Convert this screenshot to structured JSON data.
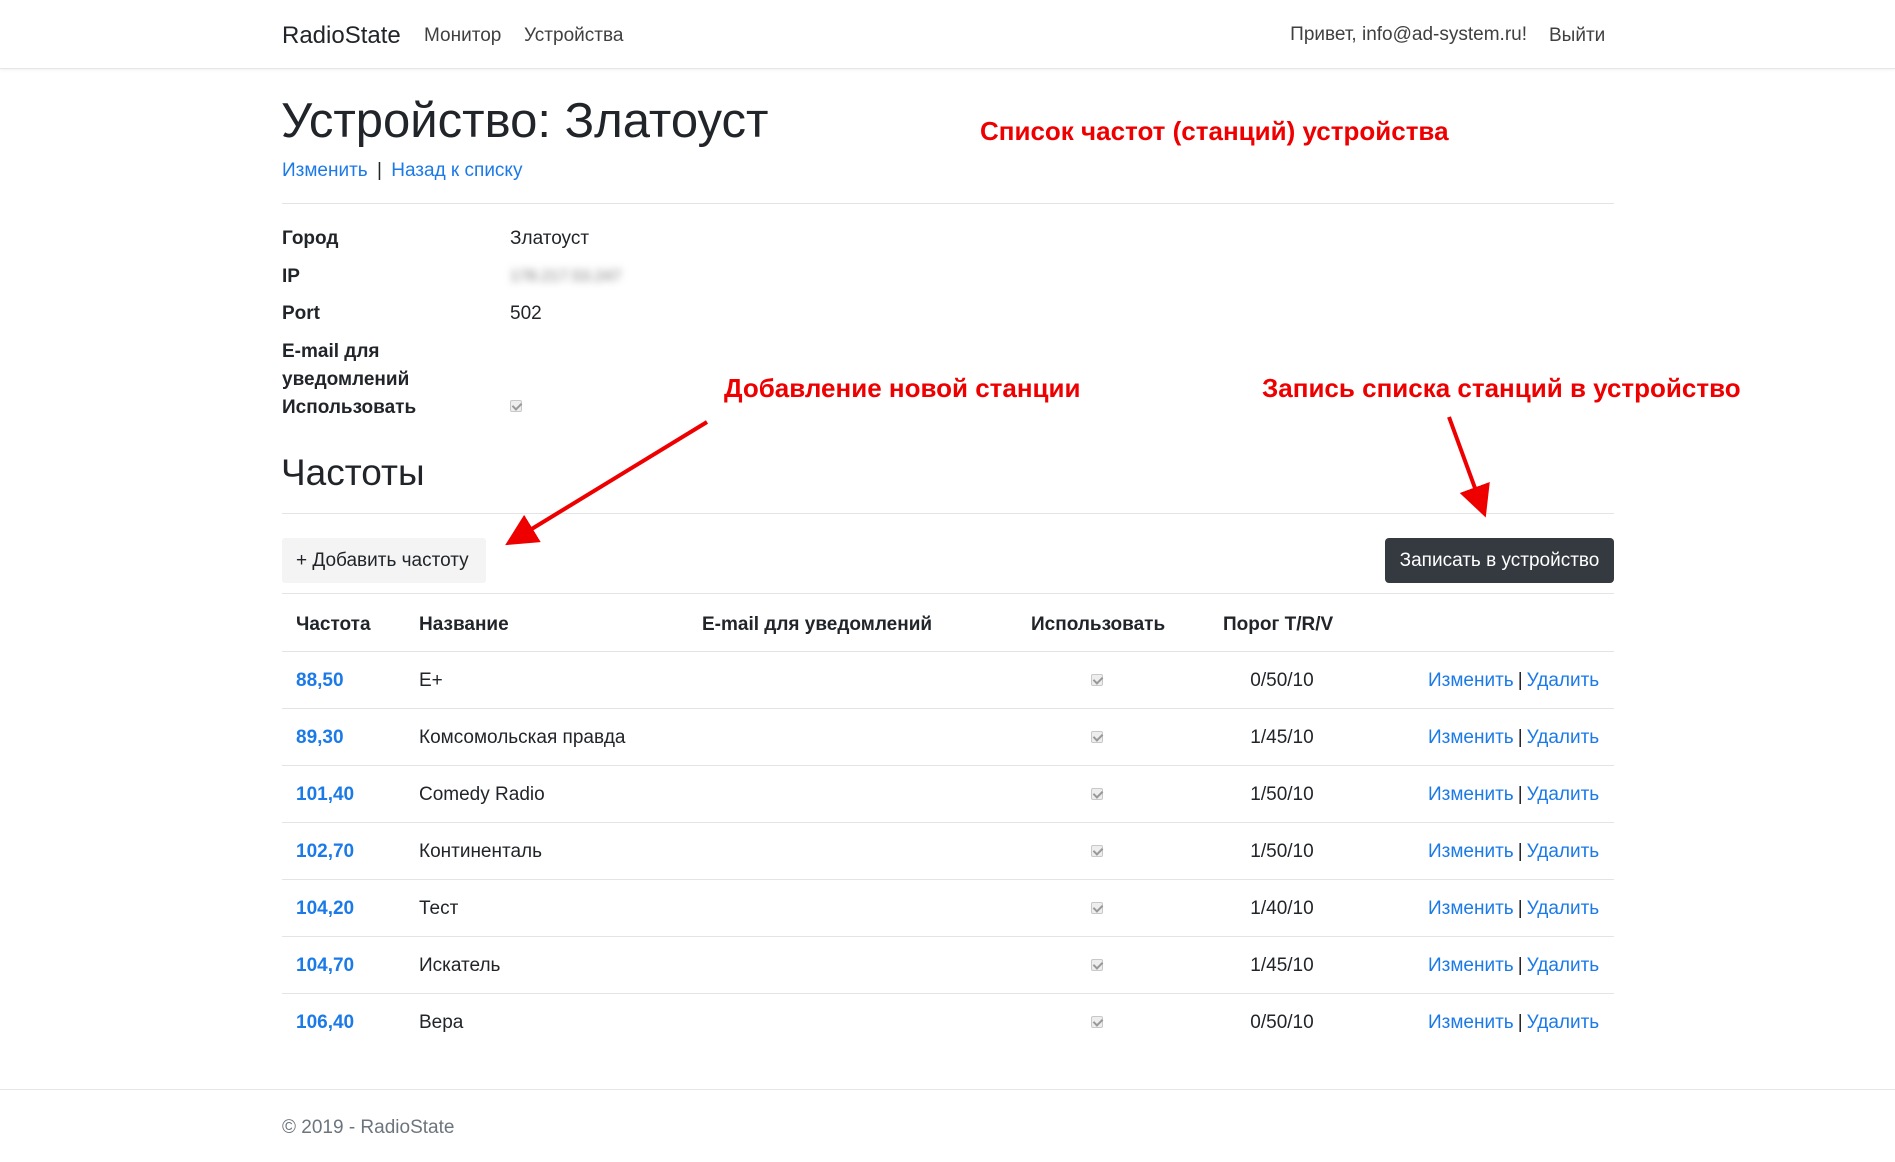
{
  "nav": {
    "brand": "RadioState",
    "monitor": "Монитор",
    "devices": "Устройства",
    "greeting": "Привет, info@ad-system.ru!",
    "logout": "Выйти"
  },
  "page": {
    "title": "Устройство: Златоуст",
    "edit_link": "Изменить",
    "separator": "|",
    "back_link": "Назад к списку"
  },
  "details": {
    "city_label": "Город",
    "city_value": "Златоуст",
    "ip_label": "IP",
    "ip_value": "178.217.53.247",
    "port_label": "Port",
    "port_value": "502",
    "email_label_line1": "E-mail для",
    "email_label_line2": "уведомлений",
    "use_label": "Использовать"
  },
  "annotations": {
    "freq_list": "Список частот (станций) устройства",
    "add_station": "Добавление новой станции",
    "write_stations": "Запись списка станций в устройство",
    "color": "#ee0000"
  },
  "frequencies": {
    "section_title": "Частоты",
    "add_button": "+ Добавить частоту",
    "write_button": "Записать в устройство",
    "columns": [
      "Частота",
      "Название",
      "E-mail для уведомлений",
      "Использовать",
      "Порог T/R/V"
    ],
    "edit_label": "Изменить",
    "delete_label": "Удалить",
    "rows": [
      {
        "freq": "88,50",
        "name": "E+",
        "email": "",
        "threshold": "0/50/10"
      },
      {
        "freq": "89,30",
        "name": "Комсомольская правда",
        "email": "",
        "threshold": "1/45/10"
      },
      {
        "freq": "101,40",
        "name": "Comedy Radio",
        "email": "",
        "threshold": "1/50/10"
      },
      {
        "freq": "102,70",
        "name": "Континенталь",
        "email": "",
        "threshold": "1/50/10"
      },
      {
        "freq": "104,20",
        "name": "Тест",
        "email": "",
        "threshold": "1/40/10"
      },
      {
        "freq": "104,70",
        "name": "Искатель",
        "email": "",
        "threshold": "1/45/10"
      },
      {
        "freq": "106,40",
        "name": "Вера",
        "email": "",
        "threshold": "0/50/10"
      }
    ]
  },
  "footer": {
    "text": "© 2019 - RadioState"
  }
}
